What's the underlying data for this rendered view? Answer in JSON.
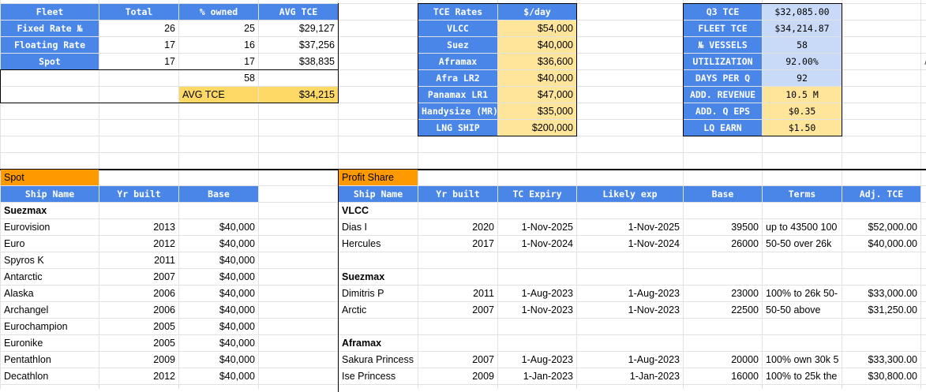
{
  "fleet_table": {
    "headers": [
      "Fleet",
      "Total",
      "% owned",
      "AVG TCE"
    ],
    "rows": [
      [
        "Fixed Rate №",
        "26",
        "25",
        "$29,127"
      ],
      [
        "Floating Rate",
        "17",
        "16",
        "$37,256"
      ],
      [
        "Spot",
        "17",
        "17",
        "$38,835"
      ]
    ],
    "owned_total": "58",
    "avg_tce_label": "AVG TCE",
    "avg_tce_value": "$34,215"
  },
  "tce_rates": {
    "headers": [
      "TCE Rates",
      "$/day"
    ],
    "rows": [
      [
        "VLCC",
        "$54,000"
      ],
      [
        "Suez",
        "$40,000"
      ],
      [
        "Aframax",
        "$36,600"
      ],
      [
        "Afra LR2",
        "$40,000"
      ],
      [
        "Panamax LR1",
        "$47,000"
      ],
      [
        "Handysize (MR)",
        "$35,000"
      ],
      [
        "LNG SHIP",
        "$200,000"
      ]
    ]
  },
  "q3_summary": {
    "rows": [
      [
        "Q3 TCE",
        "$32,085.00"
      ],
      [
        "FLEET TCE",
        "$34,214.87"
      ],
      [
        "№ VESSELS",
        "58"
      ],
      [
        "UTILIZATION",
        "92.00%"
      ],
      [
        "DAYS PER Q",
        "92"
      ],
      [
        "ADD. REVENUE",
        "10.5 M"
      ],
      [
        "ADD. Q EPS",
        "$0.35"
      ],
      [
        "LQ EARN",
        "$1.50"
      ]
    ]
  },
  "spot_section": {
    "title": "Spot",
    "headers": [
      "Ship Name",
      "Yr built",
      "Base"
    ],
    "group": "Suezmax",
    "rows": [
      [
        "Eurovision",
        "2013",
        "$40,000"
      ],
      [
        "Euro",
        "2012",
        "$40,000"
      ],
      [
        "Spyros K",
        "2011",
        "$40,000"
      ],
      [
        "Antarctic",
        "2007",
        "$40,000"
      ],
      [
        "Alaska",
        "2006",
        "$40,000"
      ],
      [
        "Archangel",
        "2006",
        "$40,000"
      ],
      [
        "Eurochampion",
        "2005",
        "$40,000"
      ],
      [
        "Euronike",
        "2005",
        "$40,000"
      ],
      [
        "Pentathlon",
        "2009",
        "$40,000"
      ],
      [
        "Decathlon",
        "2012",
        "$40,000"
      ]
    ]
  },
  "profit_share": {
    "title": "Profit Share",
    "headers": [
      "Ship Name",
      "Yr built",
      "TC Expiry",
      "Likely exp",
      "Base",
      "Terms",
      "Adj. TCE"
    ],
    "groups": [
      {
        "name": "VLCC",
        "rows": [
          [
            "Dias I",
            "2020",
            "1-Nov-2025",
            "1-Nov-2025",
            "39500",
            "up to 43500 100",
            "$52,000.00"
          ],
          [
            "Hercules",
            "2017",
            "1-Nov-2024",
            "1-Nov-2024",
            "26000",
            "50-50 over 26k",
            "$40,000.00"
          ]
        ]
      },
      {
        "name": "Suezmax",
        "rows": [
          [
            "Dimitris P",
            "2011",
            "1-Aug-2023",
            "1-Aug-2023",
            "23000",
            "100% to 26k 50-",
            "$33,000.00"
          ],
          [
            "Arctic",
            "2007",
            "1-Nov-2023",
            "1-Nov-2023",
            "22500",
            "50-50 above",
            "$31,250.00"
          ]
        ]
      },
      {
        "name": "Aframax",
        "rows": [
          [
            "Sakura Princess",
            "2007",
            "1-Aug-2023",
            "1-Aug-2023",
            "20000",
            "100% own 30k 5",
            "$33,300.00"
          ],
          [
            "Ise Princess",
            "2009",
            "1-Jan-2023",
            "1-Jan-2023",
            "16000",
            "100% to 25k the",
            "$30,800.00"
          ]
        ]
      }
    ]
  },
  "edge_glyph": "A",
  "colors": {
    "header_blue": "#4a86e8",
    "tce_yellow": "#ffe599",
    "avg_gold": "#ffd966",
    "summary_blue": "#c9daf8",
    "section_orange": "#ff9900"
  }
}
